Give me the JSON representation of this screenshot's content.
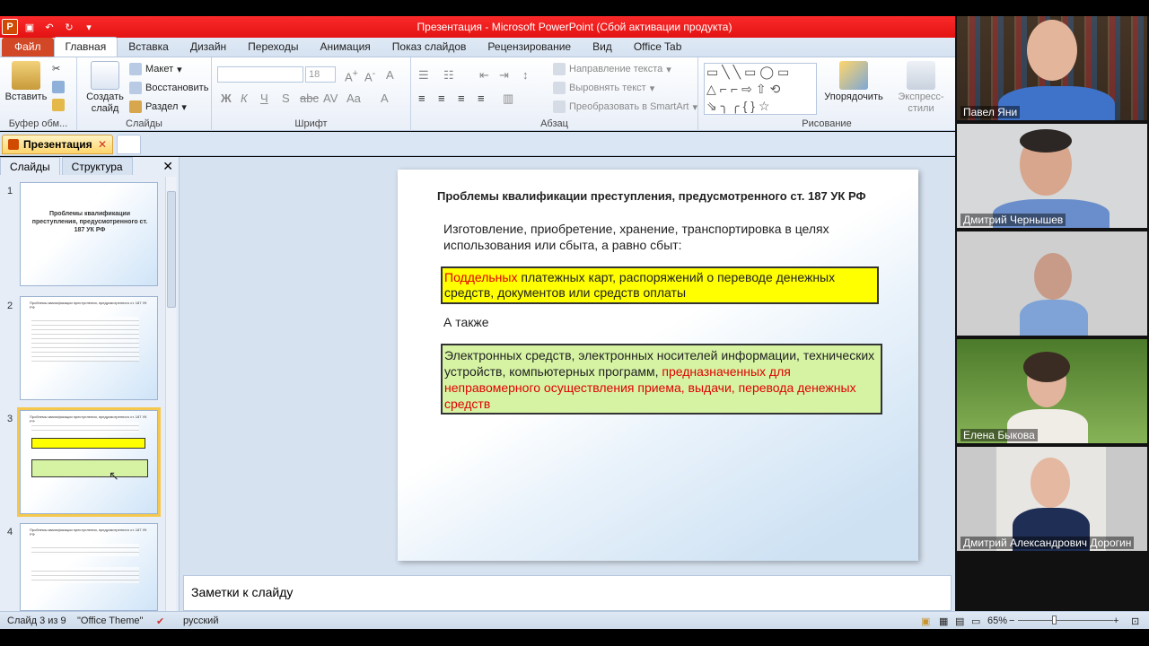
{
  "window": {
    "title": "Презентация  -  Microsoft PowerPoint (Сбой активации продукта)"
  },
  "tabs": [
    "Файл",
    "Главная",
    "Вставка",
    "Дизайн",
    "Переходы",
    "Анимация",
    "Показ слайдов",
    "Рецензирование",
    "Вид",
    "Office Tab"
  ],
  "ribbon": {
    "clipboard": {
      "paste": "Вставить",
      "label": "Буфер обм..."
    },
    "slides": {
      "create": "Создать слайд",
      "layout": "Макет",
      "reset": "Восстановить",
      "section": "Раздел",
      "label": "Слайды"
    },
    "font": {
      "size": "18",
      "label": "Шрифт"
    },
    "paragraph": {
      "direction": "Направление текста",
      "align": "Выровнять текст",
      "smartart": "Преобразовать в SmartArt",
      "label": "Абзац"
    },
    "drawing": {
      "arrange": "Упорядочить",
      "styles": "Экспресс-стили",
      "label": "Рисование"
    }
  },
  "doc_tab": {
    "name": "Презентация"
  },
  "panel": {
    "tab_slides": "Слайды",
    "tab_outline": "Структура"
  },
  "thumbnails": [
    {
      "num": "1",
      "title": "Проблемы квалификации преступления, предусмотренного ст. 187 УК РФ"
    },
    {
      "num": "2",
      "title": "Проблемы квалификации преступления, предусмотренного ст. 187 УК РФ"
    },
    {
      "num": "3",
      "title": "Проблемы квалификации преступления, предусмотренного ст. 187 УК РФ"
    },
    {
      "num": "4",
      "title": "Проблемы квалификации преступления, предусмотренного ст. 187 УК РФ"
    }
  ],
  "slide": {
    "title": "Проблемы квалификации преступления, предусмотренного ст. 187 УК РФ",
    "intro": "Изготовление, приобретение, хранение,  транспортировка в целях использования или  сбыта, а равно сбыт:",
    "yellow_red": "Поддельных",
    "yellow_rest": " платежных карт, распоряжений о переводе денежных средств, документов или средств оплаты",
    "also": "А также",
    "green_black": "Электронных средств, электронных носителей  информации, технических  устройств, компьютерных программ, ",
    "green_red": "предназначенных для неправомерного осуществления приема, выдачи, перевода денежных средств"
  },
  "notes": {
    "placeholder": "Заметки к слайду"
  },
  "status": {
    "slide": "Слайд 3 из 9",
    "theme": "\"Office Theme\"",
    "lang": "русский",
    "zoom": "65%"
  },
  "participants": [
    {
      "name": "Павел Яни"
    },
    {
      "name": "Дмитрий Чернышев"
    },
    {
      "name": ""
    },
    {
      "name": "Елена Быкова"
    },
    {
      "name": "Дмитрий Александрович Дорогин"
    }
  ],
  "colors": {
    "title_bar": "#e31313",
    "yellow_box": "#ffff00",
    "green_box": "#d6f3a4",
    "accent_red": "#e00000"
  }
}
